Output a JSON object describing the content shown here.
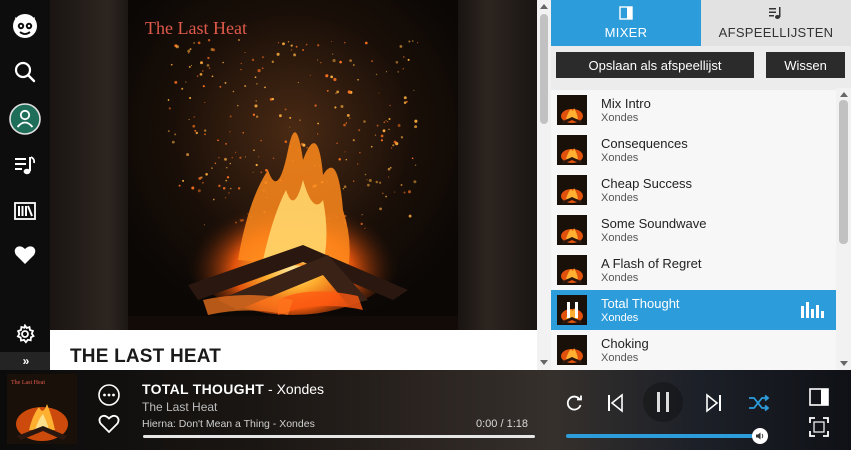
{
  "sidebar": {
    "icons": [
      "napster-logo-icon",
      "search-icon",
      "profile-icon",
      "playlist-music-icon",
      "library-icon",
      "heart-icon",
      "gear-icon"
    ],
    "expand_label": "»"
  },
  "main": {
    "album_art_text": "The Last Heat",
    "album_title": "THE LAST HEAT"
  },
  "panel": {
    "tabs": [
      {
        "label": "MIXER",
        "icon": "mixer-icon",
        "active": true
      },
      {
        "label": "AFSPEELLIJSTEN",
        "icon": "playlist-icon",
        "active": false
      }
    ],
    "save_label": "Opslaan als afspeellijst",
    "clear_label": "Wissen",
    "tracks": [
      {
        "title": "Mix Intro",
        "artist": "Xondes",
        "playing": false
      },
      {
        "title": "Consequences",
        "artist": "Xondes",
        "playing": false
      },
      {
        "title": "Cheap Success",
        "artist": "Xondes",
        "playing": false
      },
      {
        "title": "Some Soundwave",
        "artist": "Xondes",
        "playing": false
      },
      {
        "title": "A Flash of Regret",
        "artist": "Xondes",
        "playing": false
      },
      {
        "title": "Total Thought",
        "artist": "Xondes",
        "playing": true
      },
      {
        "title": "Choking",
        "artist": "Xondes",
        "playing": false
      }
    ]
  },
  "player": {
    "track_title": "TOTAL THOUGHT",
    "separator": " - ",
    "artist": "Xondes",
    "album": "The Last Heat",
    "up_next": "Hierna: Don't Mean a Thing - Xondes",
    "time": "0:00 / 1:18",
    "progress": 0.0,
    "volume": 1.0,
    "accent_color": "#2d9cdb",
    "controls": [
      "repeat-icon",
      "previous-icon",
      "pause-icon",
      "next-icon",
      "shuffle-icon",
      "queue-panel-icon",
      "fullscreen-icon"
    ]
  }
}
